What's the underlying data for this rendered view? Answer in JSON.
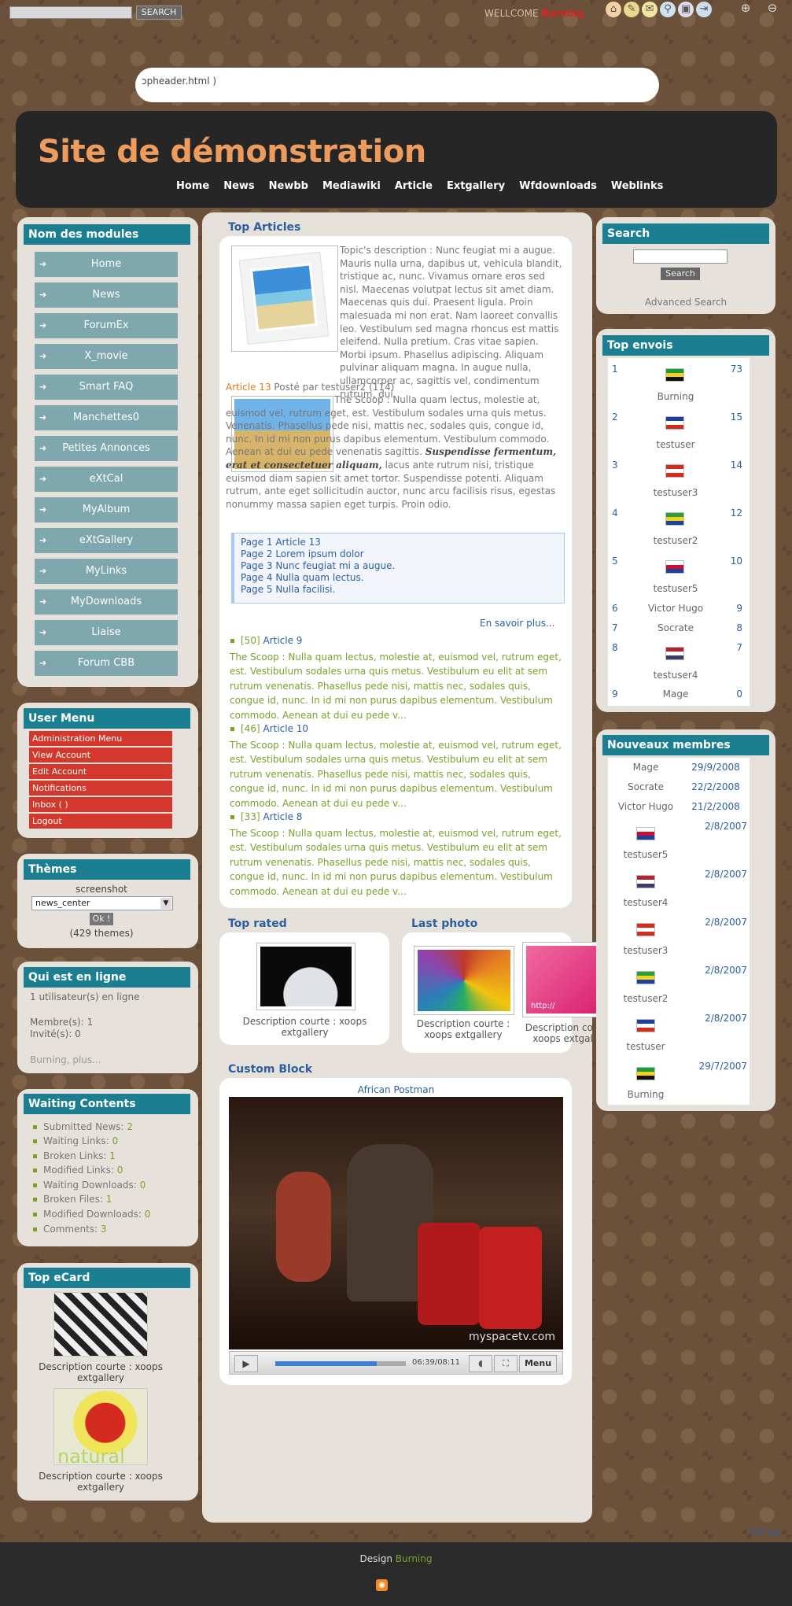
{
  "topbar": {
    "search_button": "SEARCH",
    "welcome": "WELLCOME",
    "username": "Burning"
  },
  "include_text": "ɔpheader.html )",
  "site_title": "Site de démonstration",
  "nav": [
    "Home",
    "News",
    "Newbb",
    "Mediawiki",
    "Article",
    "Extgallery",
    "Wfdownloads",
    "Weblinks"
  ],
  "modules": {
    "title": "Nom des modules",
    "items": [
      "Home",
      "News",
      "ForumEx",
      "X_movie",
      "Smart FAQ",
      "Manchettes0",
      "Petites Annonces",
      "eXtCal",
      "MyAlbum",
      "eXtGallery",
      "MyLinks",
      "MyDownloads",
      "Liaise",
      "Forum CBB"
    ]
  },
  "user_menu": {
    "title": "User Menu",
    "items": [
      "Administration Menu",
      "View Account",
      "Edit Account",
      "Notifications",
      "Inbox ( )",
      "Logout"
    ]
  },
  "themes": {
    "title": "Thèmes",
    "screenshot": "screenshot",
    "selected": "news_center",
    "ok": "Ok !",
    "count": "(429 themes)"
  },
  "online": {
    "title": "Qui est en ligne",
    "users": "1 utilisateur(s) en ligne",
    "members": "Membre(s): 1",
    "guests": "Invité(s): 0",
    "more": "Burning, plus..."
  },
  "waiting": {
    "title": "Waiting Contents",
    "items": [
      {
        "label": "Submitted News:",
        "value": "2"
      },
      {
        "label": "Waiting Links:",
        "value": "0"
      },
      {
        "label": "Broken Links:",
        "value": "1"
      },
      {
        "label": "Modified Links:",
        "value": "0"
      },
      {
        "label": "Waiting Downloads:",
        "value": "0"
      },
      {
        "label": "Broken Files:",
        "value": "1"
      },
      {
        "label": "Modified Downloads:",
        "value": "0"
      },
      {
        "label": "Comments:",
        "value": "3"
      }
    ]
  },
  "ecard": {
    "title": "Top eCard",
    "items": [
      "Description courte : xoops extgallery",
      "Description courte : xoops extgallery"
    ],
    "img2_text": "natural"
  },
  "top_articles": {
    "title": "Top Articles",
    "topic_desc": "Topic's description : Nunc feugiat mi a augue. Mauris nulla urna, dapibus ut, vehicula blandit, tristique ac, nunc. Vivamus ornare eros sed nisl. Maecenas volutpat lectus sit amet diam. Maecenas quis dui. Praesent ligula. Proin malesuada mi non erat. Nam laoreet convallis leo. Vestibulum sed magna rhoncus est mattis eleifend. Nulla pretium. Cras vitae sapien. Morbi ipsum. Phasellus adipiscing. Aliquam pulvinar aliquam magna. In augue nulla, ullamcorper ac, sagittis vel, condimentum rutrum, dui.",
    "article_link": "Article 13",
    "article_meta": "Posté par testuser2 (114)",
    "scoop_part1": "The Scoop : Nulla quam lectus, molestie at, euismod vel, rutrum eget, est. Vestibulum sodales urna quis metus. Venenatis. Phasellus pede nisi, mattis nec, sodales quis, congue id, nunc. In id mi non purus dapibus elementum. Vestibulum commodo. Aenean at dui eu pede venenatis sagittis.",
    "scoop_bold": "Suspendisse fermentum, erat et consectetuer aliquam,",
    "scoop_part2": "lacus ante rutrum nisi, tristique euismod diam sapien sit amet tortor. Suspendisse potenti. Aliquam rutrum, ante eget sollicitudin auctor, nunc arcu facilisis risus, egestas nonummy massa sapien eget turpis. Proin odio.",
    "pages": [
      "Page 1 Article 13",
      "Page 2 Lorem ipsum dolor",
      "Page 3 Nunc feugiat mi a augue.",
      "Page 4 Nulla quam lectus.",
      "Page 5 Nulla facilisi."
    ],
    "more": "En savoir plus...",
    "list": [
      {
        "count": "[50]",
        "title": "Article 9",
        "text": "The Scoop : Nulla quam lectus, molestie at, euismod vel, rutrum eget, est. Vestibulum sodales urna quis metus. Vestibulum eu elit at sem rutrum venenatis. Phasellus pede nisi, mattis nec, sodales quis, congue id, nunc. In id mi non purus dapibus elementum. Vestibulum commodo. Aenean at dui eu pede v..."
      },
      {
        "count": "[46]",
        "title": "Article 10",
        "text": "The Scoop : Nulla quam lectus, molestie at, euismod vel, rutrum eget, est. Vestibulum sodales urna quis metus. Vestibulum eu elit at sem rutrum venenatis. Phasellus pede nisi, mattis nec, sodales quis, congue id, nunc. In id mi non purus dapibus elementum. Vestibulum commodo. Aenean at dui eu pede v..."
      },
      {
        "count": "[33]",
        "title": "Article 8",
        "text": "The Scoop : Nulla quam lectus, molestie at, euismod vel, rutrum eget, est. Vestibulum sodales urna quis metus. Vestibulum eu elit at sem rutrum venenatis. Phasellus pede nisi, mattis nec, sodales quis, congue id, nunc. In id mi non purus dapibus elementum. Vestibulum commodo. Aenean at dui eu pede v..."
      }
    ]
  },
  "top_rated": {
    "title": "Top rated",
    "desc": "Description courte : xoops extgallery"
  },
  "last_photo": {
    "title": "Last photo",
    "items": [
      "Description courte : xoops extgallery",
      "Description courte : xoops extgallery"
    ],
    "img2_text": "http://"
  },
  "custom": {
    "title": "Custom Block",
    "video_title": "African Postman",
    "watermark": "myspacetv.com",
    "time": "06:39/08:11",
    "menu": "Menu",
    "progress": 0.78
  },
  "search": {
    "title": "Search",
    "button": "Search",
    "advanced": "Advanced Search"
  },
  "top_envois": {
    "title": "Top envois",
    "rows": [
      {
        "rank": "1",
        "name": "Burning",
        "count": "73",
        "flag": [
          "#1a9c3a",
          "#f2d21b",
          "#111"
        ]
      },
      {
        "rank": "2",
        "name": "testuser",
        "count": "15",
        "flag": [
          "#1f3f9f",
          "#ffffff",
          "#d52b1e"
        ]
      },
      {
        "rank": "3",
        "name": "testuser3",
        "count": "14",
        "flag": [
          "#d52b1e",
          "#ffffff",
          "#d52b1e"
        ]
      },
      {
        "rank": "4",
        "name": "testuser2",
        "count": "12",
        "flag": [
          "#2a9d3c",
          "#f2d21b",
          "#1f3f9f"
        ]
      },
      {
        "rank": "5",
        "name": "testuser5",
        "count": "10",
        "flag": [
          "#ffffff",
          "#c8102e",
          "#1f3f9f"
        ]
      },
      {
        "rank": "6",
        "name": "Victor Hugo",
        "count": "9"
      },
      {
        "rank": "7",
        "name": "Socrate",
        "count": "8"
      },
      {
        "rank": "8",
        "name": "testuser4",
        "count": "7",
        "flag": [
          "#b22234",
          "#ffffff",
          "#3c3b6e"
        ]
      },
      {
        "rank": "9",
        "name": "Mage",
        "count": "0"
      }
    ]
  },
  "nouveaux": {
    "title": "Nouveaux membres",
    "rows": [
      {
        "name": "Mage",
        "date": "29/9/2008"
      },
      {
        "name": "Socrate",
        "date": "22/2/2008"
      },
      {
        "name": "Victor Hugo",
        "date": "21/2/2008"
      },
      {
        "name": "testuser5",
        "date": "2/8/2007",
        "flag": [
          "#ffffff",
          "#c8102e",
          "#1f3f9f"
        ]
      },
      {
        "name": "testuser4",
        "date": "2/8/2007",
        "flag": [
          "#b22234",
          "#ffffff",
          "#3c3b6e"
        ]
      },
      {
        "name": "testuser3",
        "date": "2/8/2007",
        "flag": [
          "#d52b1e",
          "#ffffff",
          "#d52b1e"
        ]
      },
      {
        "name": "testuser2",
        "date": "2/8/2007",
        "flag": [
          "#2a9d3c",
          "#f2d21b",
          "#1f3f9f"
        ]
      },
      {
        "name": "testuser",
        "date": "2/8/2007",
        "flag": [
          "#1f3f9f",
          "#ffffff",
          "#d52b1e"
        ]
      },
      {
        "name": "Burning",
        "date": "29/7/2007",
        "flag": [
          "#1a9c3a",
          "#f2d21b",
          "#111"
        ]
      }
    ]
  },
  "footer": {
    "design": "Design",
    "author": "Burning",
    "top": "TOP top"
  }
}
